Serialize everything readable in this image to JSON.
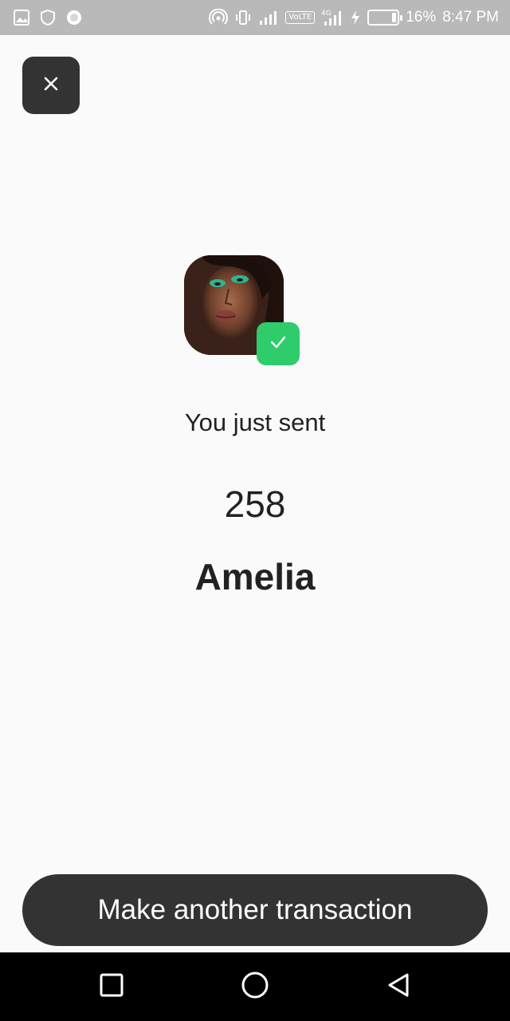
{
  "status_bar": {
    "battery_percent": "16%",
    "time": "8:47 PM",
    "network_label": "VoLTE",
    "signal_label": "4G",
    "icons": [
      "gallery-icon",
      "shield-icon",
      "record-icon",
      "hotspot-icon",
      "vibrate-icon",
      "signal-icon",
      "volte-icon",
      "signal-4g-icon",
      "charging-icon",
      "battery-icon"
    ]
  },
  "header": {
    "close_icon": "close-icon"
  },
  "confirmation": {
    "avatar_alt": "Amelia",
    "badge_icon": "check-icon",
    "badge_color": "#2ecc6b",
    "sent_label": "You just sent",
    "amount": "258",
    "recipient": "Amelia"
  },
  "actions": {
    "primary_label": "Make another transaction"
  },
  "nav_bar": {
    "buttons": [
      "recents-icon",
      "home-icon",
      "back-icon"
    ]
  },
  "colors": {
    "dark_button": "#333333",
    "background": "#fafafa",
    "status_bar": "#b9b9b9",
    "accent_green": "#2ecc6b"
  }
}
